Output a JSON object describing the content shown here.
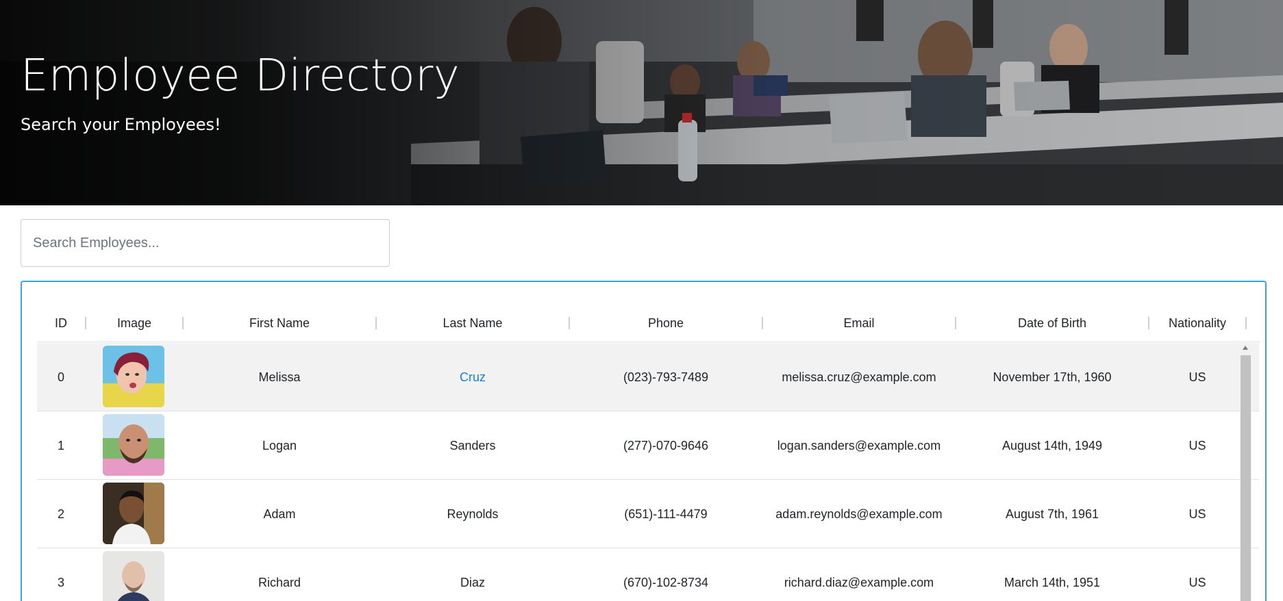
{
  "hero": {
    "title": "Employee Directory",
    "subtitle": "Search your Employees!"
  },
  "search": {
    "placeholder": "Search Employees...",
    "value": ""
  },
  "table": {
    "columns": [
      "ID",
      "Image",
      "First Name",
      "Last Name",
      "Phone",
      "Email",
      "Date of Birth",
      "Nationality"
    ],
    "rows": [
      {
        "id": "0",
        "first": "Melissa",
        "last": "Cruz",
        "phone": "(023)-793-7489",
        "email": "melissa.cruz@example.com",
        "dob": "November 17th, 1960",
        "nat": "US"
      },
      {
        "id": "1",
        "first": "Logan",
        "last": "Sanders",
        "phone": "(277)-070-9646",
        "email": "logan.sanders@example.com",
        "dob": "August 14th, 1949",
        "nat": "US"
      },
      {
        "id": "2",
        "first": "Adam",
        "last": "Reynolds",
        "phone": "(651)-111-4479",
        "email": "adam.reynolds@example.com",
        "dob": "August 7th, 1961",
        "nat": "US"
      },
      {
        "id": "3",
        "first": "Richard",
        "last": "Diaz",
        "phone": "(670)-102-8734",
        "email": "richard.diaz@example.com",
        "dob": "March 14th, 1951",
        "nat": "US"
      }
    ]
  },
  "colors": {
    "accent_border": "#3aa3e3",
    "link": "#1a7fd4",
    "striped_row": "#f2f2f2"
  }
}
